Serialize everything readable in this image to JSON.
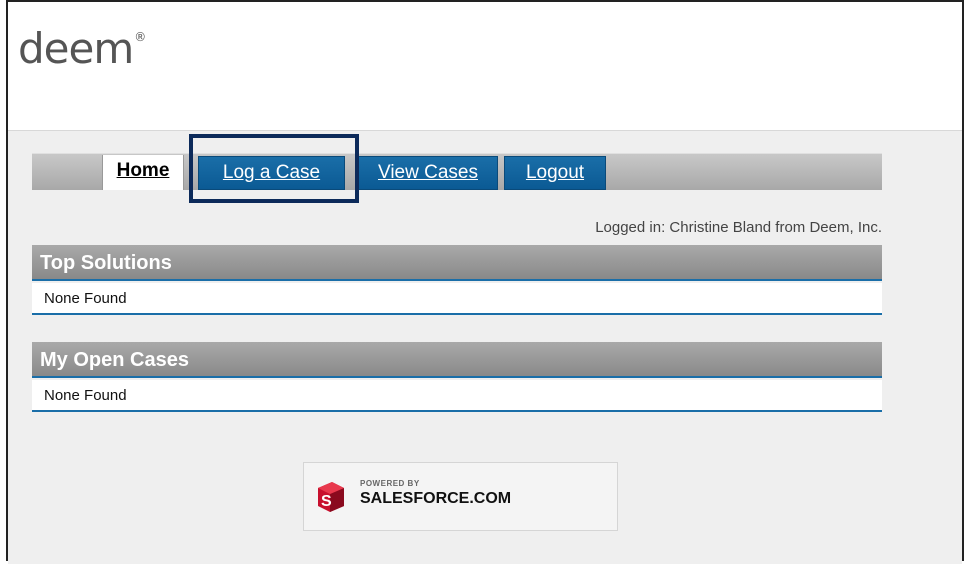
{
  "brand": {
    "logo_text": "deem",
    "logo_mark": "®"
  },
  "tabs": [
    {
      "label": "Home"
    },
    {
      "label": "Log a Case"
    },
    {
      "label": "View Cases"
    },
    {
      "label": "Logout"
    }
  ],
  "status": {
    "logged_in_text": "Logged in: Christine Bland from Deem, Inc."
  },
  "sections": {
    "top_solutions": {
      "title": "Top Solutions",
      "body": "None Found"
    },
    "open_cases": {
      "title": "My Open Cases",
      "body": "None Found"
    }
  },
  "footer": {
    "powered_by": "POWERED BY",
    "salesforce": "SALESFORCE.COM"
  },
  "colors": {
    "tab_blue": "#0b5a94",
    "highlight_border": "#0c2a5a",
    "section_gray": "#898989",
    "rule_blue": "#1a6ea8"
  }
}
